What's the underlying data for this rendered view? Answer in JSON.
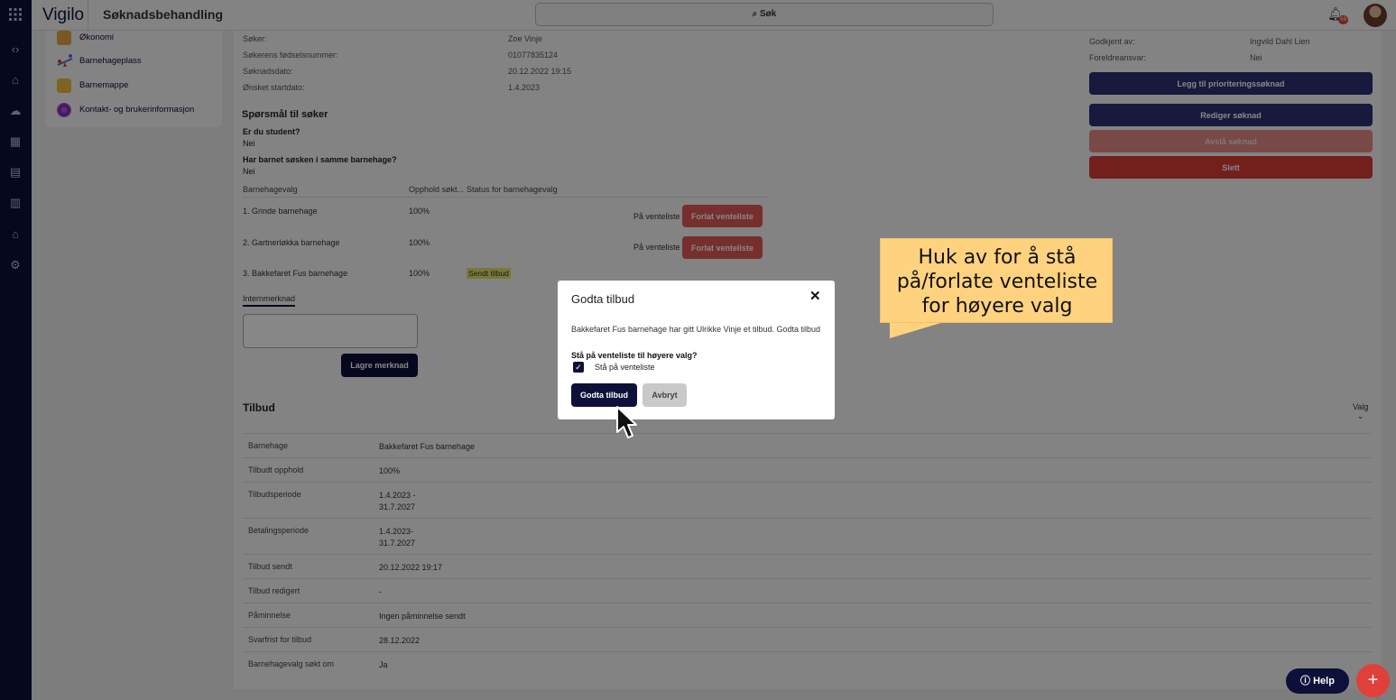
{
  "app": {
    "brand": "Vigilo",
    "page_title": "Søknadsbehandling",
    "search_label": "Søk",
    "notification_count": "59"
  },
  "sidebar": {
    "items": [
      {
        "label": "Økonomi",
        "icon": "coins-icon"
      },
      {
        "label": "Barnehageplass",
        "icon": "seesaw-icon"
      },
      {
        "label": "Barnemappe",
        "icon": "folder-icon"
      },
      {
        "label": "Kontakt- og brukerinformasjon",
        "icon": "fingerprint-icon"
      }
    ]
  },
  "applicant": {
    "rows": [
      {
        "label": "Søker:",
        "value": "Zoe Vinje"
      },
      {
        "label": "Søkerens fødselsnummer:",
        "value": "01077835124"
      },
      {
        "label": "Søknadsdato:",
        "value": "20.12.2022 19:15"
      },
      {
        "label": "Ønsket startdato:",
        "value": "1.4.2023"
      }
    ]
  },
  "questions": {
    "title": "Spørsmål til søker",
    "items": [
      {
        "q": "Er du student?",
        "a": "Nei"
      },
      {
        "q": "Har barnet søsken i samme barnehage?",
        "a": "Nei"
      }
    ]
  },
  "kindergarten_choices": {
    "headers": [
      "Barnehagevalg",
      "Opphold søkt...",
      "Status for barnehagevalg"
    ],
    "rows": [
      {
        "name": "1. Grinde barnehage",
        "pct": "100%",
        "status": "På venteliste",
        "action": "Forlat venteliste"
      },
      {
        "name": "2. Gartnerløkka barnehage",
        "pct": "100%",
        "status": "På venteliste",
        "action": "Forlat venteliste"
      },
      {
        "name": "3. Bakkefaret Fus barnehage",
        "pct": "100%",
        "badge": "Sendt tilbud"
      }
    ]
  },
  "note": {
    "tab_label": "Internmerknad",
    "save_label": "Lagre merknad"
  },
  "approval": {
    "rows": [
      {
        "label": "Godkjent av:",
        "value": "Ingvild Dahl Lien"
      },
      {
        "label": "Foreldreansvar:",
        "value": "Nei"
      }
    ]
  },
  "actions": {
    "priority": "Legg til prioriteringssøknad",
    "edit": "Rediger søknad",
    "reject": "Avslå søknad",
    "delete": "Slett"
  },
  "offer": {
    "title": "Tilbud",
    "options_label": "Valg",
    "rows": [
      {
        "label": "Barnehage",
        "value": "Bakkefaret Fus barnehage"
      },
      {
        "label": "Tilbudt opphold",
        "value": "100%"
      },
      {
        "label": "Tilbudsperiode",
        "value": "1.4.2023 -",
        "value2": "31.7.2027"
      },
      {
        "label": "Betalingsperiode",
        "value": "1.4.2023-",
        "value2": "31.7.2027"
      },
      {
        "label": "Tilbud sendt",
        "value": "20.12.2022 19:17"
      },
      {
        "label": "Tilbud redigert",
        "value": "-"
      },
      {
        "label": "Påminnelse",
        "value": "Ingen påminnelse sendt"
      },
      {
        "label": "Svarfrist for tilbud",
        "value": "28.12.2022"
      },
      {
        "label": "Barnehagevalg søkt om",
        "value": "Ja"
      }
    ]
  },
  "dialog": {
    "title": "Godta tilbud",
    "message": "Bakkefaret Fus barnehage har gitt Ulrikke Vinje et tilbud. Godta tilbud",
    "question": "Stå på venteliste til høyere valg?",
    "checkbox_label": "Stå på venteliste",
    "checkbox_checked": true,
    "confirm_label": "Godta tilbud",
    "cancel_label": "Avbryt"
  },
  "callout": {
    "line1": "Huk av for å stå",
    "line2": "på/forlate venteliste",
    "line3": "for høyere valg"
  },
  "floating": {
    "help_label": "Help",
    "help_icon": "question-circle-icon",
    "add_icon": "plus-icon"
  },
  "colors": {
    "navy": "#0d1038",
    "danger": "#e0403a",
    "callout": "#ffd27f",
    "badge": "#e3e26a"
  }
}
